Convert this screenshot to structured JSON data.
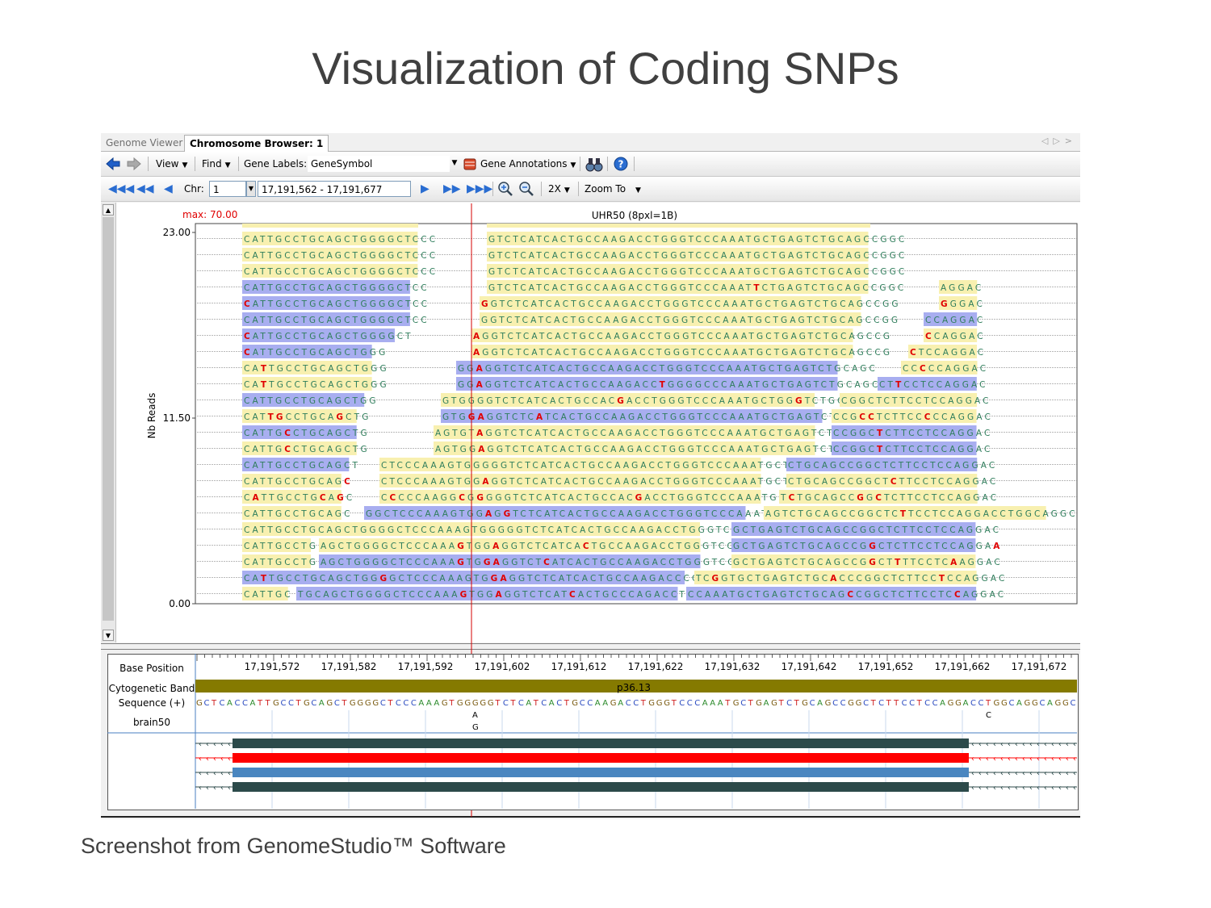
{
  "slide": {
    "title": "Visualization of Coding SNPs",
    "caption": "Screenshot from GenomeStudio™ Software"
  },
  "tabs": [
    {
      "label": "Genome Viewer",
      "active": false
    },
    {
      "label": "Chromosome Browser: 1",
      "active": true
    }
  ],
  "toolbar": {
    "view": "View",
    "find": "Find",
    "gene_labels_label": "Gene Labels:",
    "gene_labels_value": "GeneSymbol",
    "gene_annotations": "Gene Annotations",
    "chr_label": "Chr:",
    "chr_value": "1",
    "range_value": "17,191,562 - 17,191,677",
    "zoom_factor": "2X",
    "zoom_to": "Zoom To"
  },
  "icons": [
    "back-arrow-icon",
    "forward-arrow-icon",
    "gene-annotations-icon",
    "binoculars-icon",
    "help-icon",
    "zoom-in-icon",
    "zoom-out-icon",
    "first-page-icon",
    "prev-page-icon",
    "prev-icon",
    "next-icon",
    "next-page-icon",
    "last-page-icon"
  ],
  "colors": {
    "read_forward": "#f8f0b0",
    "read_reverse": "#a8aef0",
    "base_text": "#2e7d5b",
    "snp": "#e00000",
    "cursor": "#d40000",
    "cyto_band": "#857a00",
    "transcript_dark": "#2c4a4a",
    "transcript_red": "#ff0000",
    "transcript_blue": "#4a86c0"
  },
  "read_panel": {
    "max_label": "max: 70.00",
    "track_title": "UHR50  (8pxl=1B)",
    "ylabel": "Nb Reads",
    "yticks": [
      "23.00",
      "11.50",
      "0.00"
    ],
    "reads": [
      [
        [
          300,
          "CATTGCCTGCAGCTGGGGCTCCC",
          "f"
        ],
        [
          603,
          "GTCTCATCACTGCCAAGACCTGGGTCCCAAATGCTGAGTCTGCAGCCGGC",
          "f"
        ]
      ],
      [
        [
          300,
          "CATTGCCTGCAGCTGGGGCTCCC",
          "f"
        ],
        [
          603,
          "GTCTCATCACTGCCAAGACCTGGGTCCCAAATGCTGAGTCTGCAGCCGGC",
          "f"
        ]
      ],
      [
        [
          300,
          "CATTGCCTGCAGCTGGGGCTCCC",
          "f"
        ],
        [
          603,
          "GTCTCATCACTGCCAAGACCTGGGTCCCAAATGCTGAGTCTGCAGCCGGC",
          "f"
        ]
      ],
      [
        [
          300,
          "CATTGCCTGCAGCTGGGGCTCC",
          "r"
        ],
        [
          603,
          "GTCTCATCACTGCCAAGACCTGGGTCCCAAATTCTGAGTCTGCAGCCGGC",
          "f"
        ],
        [
          1163,
          "AGGAC",
          "f"
        ]
      ],
      [
        [
          300,
          "CATTGCCTGCAGCTGGGGCTCC",
          "r"
        ],
        [
          594,
          "GGTCTCATCACTGCCAAGACCTGGGTCCCAAATGCTGAGTCTGCAGCCGG",
          "f"
        ],
        [
          1163,
          "GGGAC",
          "f"
        ]
      ],
      [
        [
          300,
          "CATTGCCTGCAGCTGGGGCTCC",
          "r"
        ],
        [
          594,
          "GGTCTCATCACTGCCAAGACCTGGGTCCCAAATGCTGAGTCTGCAGCCGG",
          "f"
        ],
        [
          1144,
          "CCAGGAC",
          "r"
        ]
      ],
      [
        [
          300,
          "CATTGCCTGCAGCTGGGGCT",
          "r"
        ],
        [
          584,
          "AGGTCTCATCACTGCCAAGACCTGGGTCCCAAATGCTGAGTCTGCAGCCG",
          "f"
        ],
        [
          1144,
          "CCAGGAC",
          "f"
        ]
      ],
      [
        [
          300,
          "CATTGCCTGCAGCTGGG",
          "r"
        ],
        [
          584,
          "AGGTCTCATCACTGCCAAGACCTGGGTCCCAAATGCTGAGTCTGCAGCCG",
          "f"
        ],
        [
          1125,
          "CTCCAGGAC",
          "f"
        ]
      ],
      [
        [
          300,
          "CATTGCCTGCAGCTGGG",
          "f"
        ],
        [
          565,
          "GGAGGTCTCATCACTGCCAAGACCTGGGTCCCAAATGCTGAGTCTGCAGC",
          "r"
        ],
        [
          1116,
          "CCCCCAGGAC",
          "f"
        ]
      ],
      [
        [
          300,
          "CATTGCCTGCAGCTGGG",
          "f"
        ],
        [
          565,
          "GGAGGTCTCATCACTGCCAAGACCTGGGGCCCAAATGCTGAGTCTGCAGC",
          "r"
        ],
        [
          1087,
          "CTTCCTCCAGGAC",
          "r"
        ]
      ],
      [
        [
          300,
          "CATTGCCTGCAGCTGG",
          "r"
        ],
        [
          546,
          "GTGGGGTCTCATCACTGCCACGACCTGGGTCCCAAATGCTGGGTCTGCA",
          "f"
        ],
        [
          1040,
          "CGGCTCTTCCTCCAGGAC",
          "f"
        ]
      ],
      [
        [
          300,
          "CATTGCCTGCAGCTG",
          "f"
        ],
        [
          546,
          "GTGGAGGTCTCATCACTGCCAAGACCTGGGTCCCAAATGCTGAGTCTGCA",
          "r"
        ],
        [
          1030,
          "CCGCCTCTTCCCCCAGGAC",
          "f"
        ]
      ],
      [
        [
          300,
          "CATTGCCTGCAGCTG",
          "r"
        ],
        [
          537,
          "AGTGTAGGTCTCATCACTGCCAAGACCTGGGTCCCAAATGCTGAGTCTGC",
          "f"
        ],
        [
          1030,
          "CCGGCTCTTCCTCCAGGAC",
          "r"
        ]
      ],
      [
        [
          300,
          "CATTGCCTGCAGCTG",
          "f"
        ],
        [
          537,
          "AGTGGAGGTCTCATCACTGCCAAGACCTGGGTCCCAAATGCTGAGTCTGC",
          "f"
        ],
        [
          1030,
          "CCGGCTCTTCCTCCAGGAC",
          "r"
        ]
      ],
      [
        [
          300,
          "CATTGCCTGCAGCT",
          "r"
        ],
        [
          470,
          "CTCCCAAAGTGGGGGTCTCATCACTGCCAAGACCTGGGTCCCAAATGCTG",
          "f"
        ],
        [
          974,
          "CTGCAGCCGGCTCTTCCTCCAGGAC",
          "r"
        ]
      ],
      [
        [
          300,
          "CATTGCCTGCAGC",
          "f"
        ],
        [
          470,
          "CTCCCAAAGTGGAGGTCTCATCACTGCCAAGACCTGGGTCCCAAATGCTG",
          "f"
        ],
        [
          974,
          "CTGCAGCCGGCTCTTCCTCCAGGAC",
          "f"
        ]
      ],
      [
        [
          300,
          "CATTGCCTGCAGC",
          "f"
        ],
        [
          470,
          "CCCCCAAGGCGGGGGTCTCATCACTGCCACGACCTGGGTCCCAAATGCTG",
          "f"
        ],
        [
          965,
          "TCTGCAGCCGGCTCTTCCTCCAGGAC",
          "f"
        ]
      ],
      [
        [
          300,
          "CATTGCCTGCAGC",
          "f"
        ],
        [
          451,
          "GGCTCCCAAAGTGGAGGTCTCATCACTGCCAAGACCTGGGTCCCAAATGC",
          "r"
        ],
        [
          946,
          "AGTCTGCAGCCGGCTCTTCCTCCAGGACCTGGCAGGC",
          "f"
        ]
      ],
      [
        [
          300,
          "CATTGCCTGCAGCTGGGGCTCCCAAAGTGGGGGTCTCATCACTGCCAAGACCTGGGTCCC",
          "f"
        ],
        [
          906,
          "GCTGAGTCTGCAGCCGGCTCTTCCTCCAGGAC",
          "r"
        ]
      ],
      [
        [
          300,
          "CATTGCCTG",
          "f"
        ],
        [
          395,
          "AGCTGGGGCTCCCAAAGTGGAGGTCTCATCACTGCCAAGACCTGGGTCCC",
          "f"
        ],
        [
          906,
          "GCTGAGTCTGCAGCCGGCTCTTCCTCCAGGAA",
          "r"
        ]
      ],
      [
        [
          300,
          "CATTGCCTG",
          "f"
        ],
        [
          395,
          "AGCTGGGGCTCCCAAAGTGGAGGTCTCATCACTGCCAAGACCTGGGTCCC",
          "r"
        ],
        [
          906,
          "GCTGAGTCTGCAGCCGGCTTTTCCTCAAGGAC",
          "f"
        ]
      ],
      [
        [
          300,
          "CATTGCCTGCAGCTGGGGCTCCCAAAGTGGAGGTCTCATCACTGCCAAGACCCGGGGC",
          "r"
        ],
        [
          860,
          "TCGGTGCTGAGTCTGCACCCGGCTCTTCCTCCAGGAC",
          "f"
        ]
      ],
      [
        [
          300,
          "CATTGC",
          "f"
        ],
        [
          367,
          "TGCAGCTGGGGCTCCCAAAGTGGAGGTCTCATCACTGCCCAGACCTGGGT",
          "r"
        ],
        [
          850,
          "CCAAATGCTGAGTCTGCAGCCGGCTCTTCCTCCAGGAC",
          "r"
        ]
      ]
    ],
    "snps": [
      [
        3,
        32
      ],
      [
        4,
        0
      ],
      [
        6,
        0
      ],
      [
        7,
        0
      ],
      [
        8,
        2
      ],
      [
        9,
        2
      ],
      [
        9,
        24
      ],
      [
        10,
        21
      ],
      [
        10,
        42
      ],
      [
        11,
        4
      ],
      [
        11,
        3
      ],
      [
        11,
        11
      ],
      [
        12,
        5
      ],
      [
        13,
        5
      ],
      [
        15,
        12
      ],
      [
        16,
        1
      ],
      [
        16,
        9
      ],
      [
        16,
        11
      ],
      [
        16,
        30
      ],
      [
        17,
        16
      ],
      [
        19,
        16
      ],
      [
        19,
        31
      ],
      [
        20,
        16
      ],
      [
        20,
        19
      ],
      [
        20,
        26
      ],
      [
        21,
        29
      ],
      [
        21,
        2
      ],
      [
        21,
        16
      ],
      [
        22,
        19
      ],
      [
        22,
        32
      ]
    ]
  },
  "tracks": {
    "base_position_label": "Base Position",
    "cyto_band_label": "Cytogenetic Band",
    "sequence_label": "Sequence (+)",
    "sample_label": "brain50",
    "positions": [
      "17,191,572",
      "17,191,582",
      "17,191,592",
      "17,191,602",
      "17,191,612",
      "17,191,622",
      "17,191,632",
      "17,191,642",
      "17,191,652",
      "17,191,662",
      "17,191,672"
    ],
    "band_name": "p36.13",
    "reference_sequence": "GCTCACCATTGCCTGCAGCTGGGGCTCCCAAAGTGGGGGTCTCATCACTGCCAAGACCTGGGTCCCAAATGCTGAGTCTGCAGCCGGCTCTTCCTCCAGGACCTGGCAGGCAGGC",
    "sample_calls": [
      {
        "alleles": [
          "A",
          "G"
        ]
      },
      {
        "alleles": [
          "C"
        ]
      }
    ]
  }
}
